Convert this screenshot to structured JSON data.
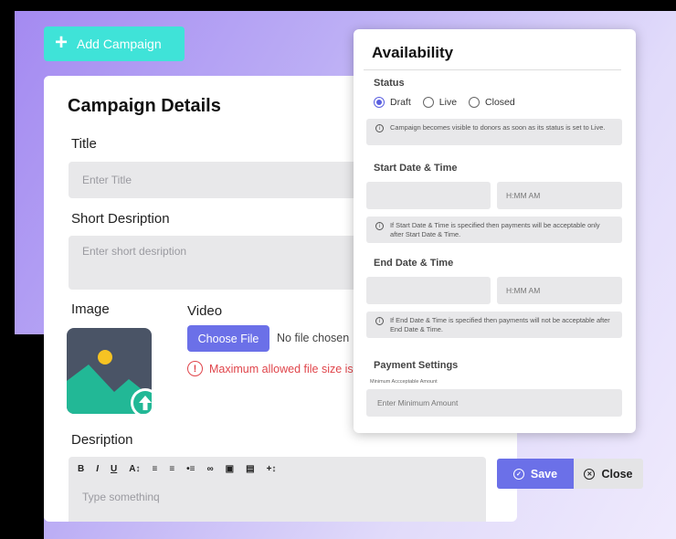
{
  "add_campaign": {
    "label": "Add Campaign",
    "icon": "plus-icon"
  },
  "campaign": {
    "heading": "Campaign Details",
    "title_label": "Title",
    "title_placeholder": "Enter Title",
    "short_desc_label": "Short Desription",
    "short_desc_placeholder": "Enter short desription",
    "image_label": "Image",
    "video_label": "Video",
    "choose_file": "Choose File",
    "no_file": "No file chosen",
    "error": "Maximum allowed file size is",
    "desc_label": "Desription",
    "desc_placeholder": "Type somethinq",
    "toolbar": [
      "B",
      "I",
      "U",
      "A↕",
      "≡",
      "≡",
      "•≡",
      "∞",
      "▣",
      "▤",
      "+↕"
    ]
  },
  "actions": {
    "save": "Save",
    "close": "Close"
  },
  "availability": {
    "heading": "Availability",
    "status_label": "Status",
    "status_options": [
      "Draft",
      "Live",
      "Closed"
    ],
    "status_selected": "Draft",
    "status_info": "Campaign becomes visible to donors as soon as its status is set to Live.",
    "start_label": "Start Date & Time",
    "start_time_placeholder": "H:MM AM",
    "start_info": "If Start Date & Time is specified then payments will be acceptable only after Start Date & Time.",
    "end_label": "End Date & Time",
    "end_time_placeholder": "H:MM AM",
    "end_info": "If End Date & Time is specified then payments will not be acceptable after End Date & Time.",
    "payment_label": "Payment Settings",
    "min_amount_label": "Minimum Accceptable Amount",
    "min_amount_placeholder": "Enter Minimum Amount"
  },
  "colors": {
    "accent": "#6b70e8",
    "teal": "#3fe3d8",
    "error": "#e0454b"
  }
}
